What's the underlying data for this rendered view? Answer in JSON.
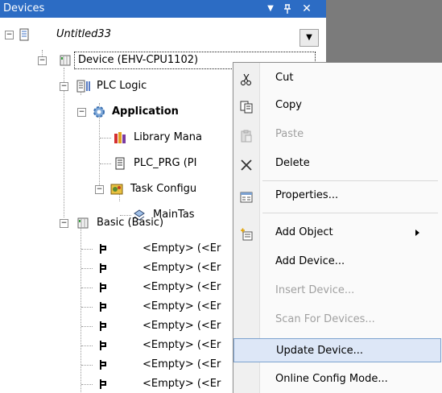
{
  "panel": {
    "title": "Devices"
  },
  "tree": [
    {
      "label": "Untitled33",
      "italic": true,
      "icon": "project-icon",
      "expand": "−"
    },
    {
      "label": "Device (EHV-CPU1102)",
      "icon": "device-icon",
      "expand": "−",
      "selected": true
    },
    {
      "label": "PLC Logic",
      "icon": "plc-logic-icon",
      "expand": "−"
    },
    {
      "label": "Application",
      "bold": true,
      "icon": "application-gear-icon",
      "expand": "−"
    },
    {
      "label": "Library Mana",
      "icon": "library-icon"
    },
    {
      "label": "PLC_PRG (PI",
      "icon": "program-icon"
    },
    {
      "label": "Task Configu",
      "icon": "task-config-icon",
      "expand": "−"
    },
    {
      "label": "MainTas",
      "icon": "task-icon"
    },
    {
      "label": "Basic (Basic)",
      "icon": "device-icon",
      "expand": "−"
    },
    {
      "label": "<Empty> (<Er",
      "icon": "empty-slot-icon"
    },
    {
      "label": "<Empty> (<Er",
      "icon": "empty-slot-icon"
    },
    {
      "label": "<Empty> (<Er",
      "icon": "empty-slot-icon"
    },
    {
      "label": "<Empty> (<Er",
      "icon": "empty-slot-icon"
    },
    {
      "label": "<Empty> (<Er",
      "icon": "empty-slot-icon"
    },
    {
      "label": "<Empty> (<Er",
      "icon": "empty-slot-icon"
    },
    {
      "label": "<Empty> (<Er",
      "icon": "empty-slot-icon"
    },
    {
      "label": "<Empty> (<Er",
      "icon": "empty-slot-icon"
    }
  ],
  "context_menu": {
    "items": [
      {
        "label": "Cut",
        "icon": "scissors-icon",
        "enabled": true
      },
      {
        "label": "Copy",
        "icon": "copy-icon",
        "enabled": true
      },
      {
        "label": "Paste",
        "icon": "paste-icon",
        "enabled": false
      },
      {
        "label": "Delete",
        "icon": "delete-x-icon",
        "enabled": true
      },
      {
        "label": "Properties...",
        "icon": "properties-icon",
        "enabled": true
      },
      {
        "label": "Add Object",
        "icon": "add-object-icon",
        "enabled": true,
        "submenu": true
      },
      {
        "label": "Add Device...",
        "enabled": true
      },
      {
        "label": "Insert Device...",
        "enabled": false
      },
      {
        "label": "Scan For Devices...",
        "enabled": false
      },
      {
        "label": "Update Device...",
        "enabled": true,
        "highlighted": true
      },
      {
        "label": "Online Config Mode...",
        "enabled": true
      }
    ]
  },
  "colors": {
    "titlebar": "#2c6cc4",
    "highlight": "#dde7f7",
    "highlight_border": "#7da2ce"
  }
}
